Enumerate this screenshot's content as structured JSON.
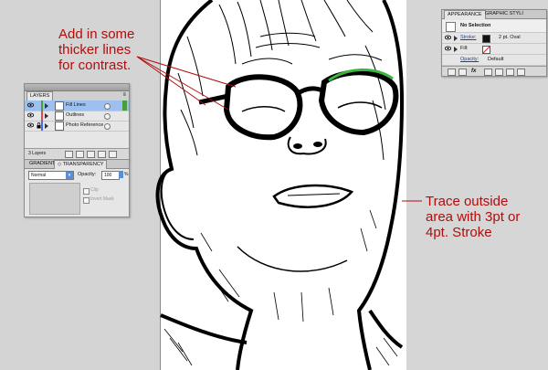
{
  "annotations": {
    "top_left": [
      "Add in some",
      "thicker lines",
      "for contrast."
    ],
    "right": [
      "Trace outside",
      "area with 3pt or",
      "4pt. Stroke"
    ]
  },
  "layers_panel": {
    "title": "LAYERS",
    "layers": [
      {
        "name": "Fill Lines",
        "color": "#4c9c3c",
        "selected": true
      },
      {
        "name": "Outlines",
        "color": "#e34848",
        "selected": false
      },
      {
        "name": "Photo Reference",
        "color": "#4d6be0",
        "selected": false
      }
    ],
    "count_label": "3 Layers"
  },
  "transparency_panel": {
    "tabs": [
      "GRADIENT",
      "◇ TRANSPARENCY"
    ],
    "blend_mode": "Normal",
    "opacity_label": "Opacity:",
    "opacity_value": "100",
    "opacity_unit": "%",
    "clip_label": "Clip",
    "invert_label": "Invert Mask"
  },
  "appearance_panel": {
    "tabs": [
      "APPEARANCE",
      "GRAPHIC STYLI"
    ],
    "selection_label": "No Selection",
    "stroke_label": "Stroke:",
    "stroke_value": "2 pt. Oval",
    "fill_label": "Fill:",
    "opacity_label": "Opacity:",
    "opacity_value": "Default",
    "footer_fx": "fx"
  },
  "colors": {
    "annotation": "#b30c0c",
    "selection_highlight": "#9cc0f0",
    "path_highlight": "#3db53d"
  }
}
